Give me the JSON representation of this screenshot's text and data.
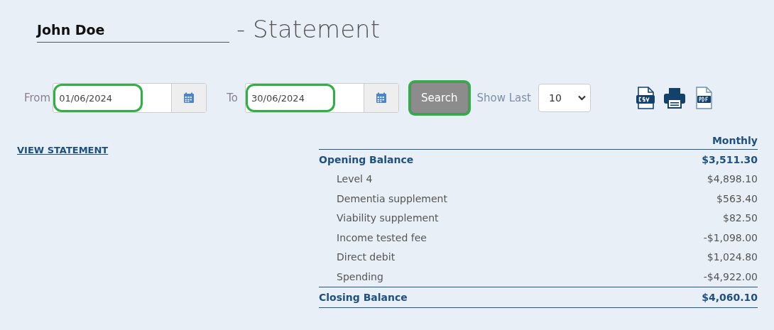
{
  "header": {
    "name": "John Doe",
    "title": "- Statement"
  },
  "filters": {
    "from_label": "From",
    "from_date": {
      "value": "01/06/2024",
      "highlighted": true
    },
    "to_label": "To",
    "to_date": {
      "value": "30/06/2024",
      "highlighted": true
    },
    "search_button": {
      "label": "Search",
      "highlighted": true
    },
    "show_last_label": "Show Last",
    "show_last": "10"
  },
  "view_statement_link": "VIEW STATEMENT",
  "table": {
    "column": "Monthly",
    "rows": [
      {
        "kind": "total",
        "label": "Opening Balance",
        "amount": "$3,511.30"
      },
      {
        "kind": "item",
        "label": "Level 4",
        "amount": "$4,898.10"
      },
      {
        "kind": "item",
        "label": "Dementia supplement",
        "amount": "$563.40"
      },
      {
        "kind": "item",
        "label": "Viability supplement",
        "amount": "$82.50"
      },
      {
        "kind": "item",
        "label": "Income tested fee",
        "amount": "-$1,098.00"
      },
      {
        "kind": "item",
        "label": "Direct debit",
        "amount": "$1,024.80"
      },
      {
        "kind": "item",
        "label": "Spending",
        "amount": "-$4,922.00"
      },
      {
        "kind": "total",
        "label": "Closing Balance",
        "amount": "$4,060.10"
      }
    ]
  }
}
